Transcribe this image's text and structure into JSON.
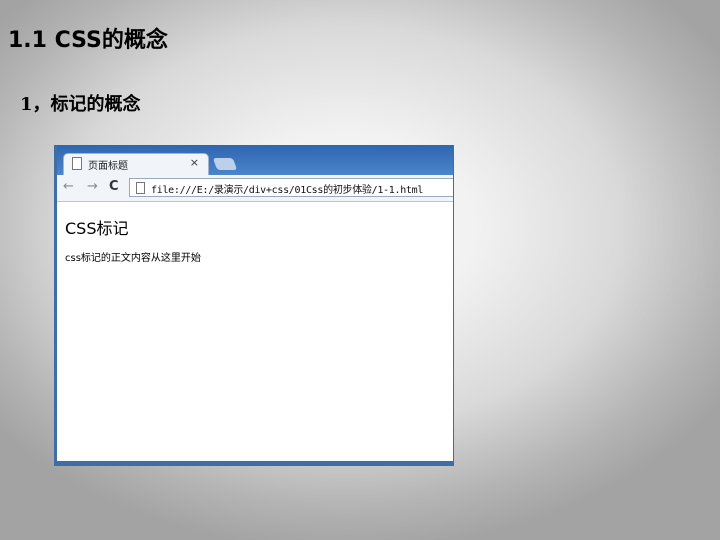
{
  "slide": {
    "title": "1.1 CSS的概念",
    "subtitle": "1，标记的概念"
  },
  "browser": {
    "tab_title": "页面标题",
    "tab_close": "×",
    "nav_back": "←",
    "nav_forward": "→",
    "nav_reload": "C",
    "address": "file:///E:/录演示/div+css/01Css的初步体验/1-1.html"
  },
  "page": {
    "heading": "CSS标记",
    "body": "css标记的正文内容从这里开始"
  },
  "icons": {
    "tab": "page-icon",
    "address": "page-icon",
    "close": "close-icon",
    "back": "arrow-left-icon",
    "forward": "arrow-right-icon",
    "reload": "reload-icon"
  },
  "colors": {
    "browser_frame": "#3e6ea8"
  }
}
